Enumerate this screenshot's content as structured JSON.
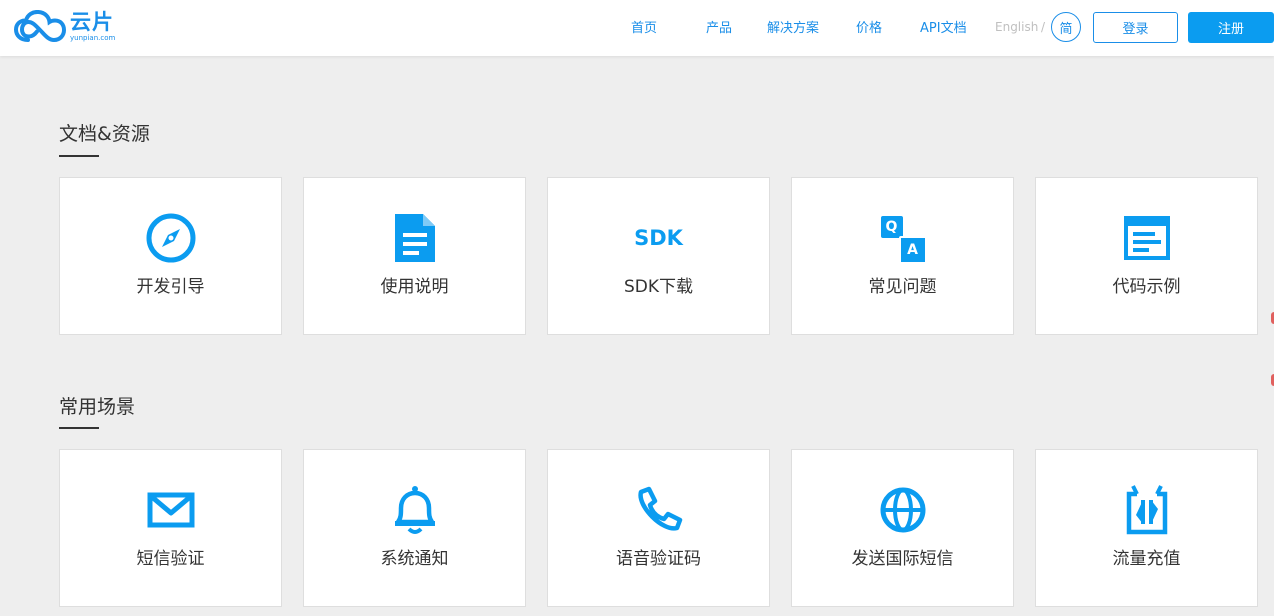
{
  "logo": {
    "cn": "云片",
    "en": "yunpian.com"
  },
  "nav": {
    "items": [
      {
        "label": "首页"
      },
      {
        "label": "产品"
      },
      {
        "label": "解决方案"
      },
      {
        "label": "价格"
      },
      {
        "label": "API文档"
      }
    ],
    "lang_english": "English",
    "lang_sep": "/",
    "lang_current": "简",
    "login": "登录",
    "register": "注册"
  },
  "sections": [
    {
      "title": "文档&资源",
      "cards": [
        {
          "label": "开发引导",
          "icon": "compass-icon"
        },
        {
          "label": "使用说明",
          "icon": "document-icon"
        },
        {
          "label": "SDK下载",
          "icon": "sdk-icon",
          "icon_text": "SDK"
        },
        {
          "label": "常见问题",
          "icon": "qa-icon",
          "icon_text_q": "Q",
          "icon_text_a": "A"
        },
        {
          "label": "代码示例",
          "icon": "code-window-icon"
        }
      ]
    },
    {
      "title": "常用场景",
      "cards": [
        {
          "label": "短信验证",
          "icon": "envelope-icon"
        },
        {
          "label": "系统通知",
          "icon": "bell-icon"
        },
        {
          "label": "语音验证码",
          "icon": "phone-icon"
        },
        {
          "label": "发送国际短信",
          "icon": "globe-icon"
        },
        {
          "label": "流量充值",
          "icon": "data-recharge-icon"
        }
      ]
    }
  ],
  "colors": {
    "accent": "#1a8ee8",
    "icon": "#0b9cf0",
    "background": "#eeeeee"
  }
}
